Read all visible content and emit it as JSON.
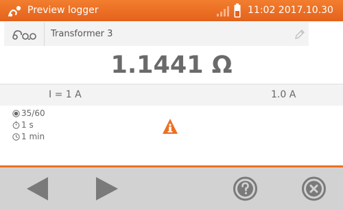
{
  "header": {
    "title": "Preview logger",
    "datetime": "11:02 2017.10.30",
    "app_icon": "logger-app-icon",
    "signal_icon": "signal-icon",
    "battery_icon": "battery-icon"
  },
  "record": {
    "name": "Transformer 3",
    "logger_icon": "logger-icon",
    "edit_icon": "pencil-icon"
  },
  "measurement": {
    "value": "1.1441 Ω"
  },
  "params": {
    "current_set": "I = 1 A",
    "current_measured": "1.0 A"
  },
  "info": {
    "samples": "35/60",
    "interval": "1 s",
    "duration": "1 min",
    "warning_icon": "warning-info-icon"
  },
  "toolbar": {
    "prev_icon": "arrow-left-icon",
    "next_icon": "arrow-right-icon",
    "help_icon": "help-icon",
    "close_icon": "close-icon"
  },
  "colors": {
    "accent": "#ed6f23",
    "toolbar_bg": "#d2d2d2",
    "icon_gray": "#7a7a7a"
  }
}
